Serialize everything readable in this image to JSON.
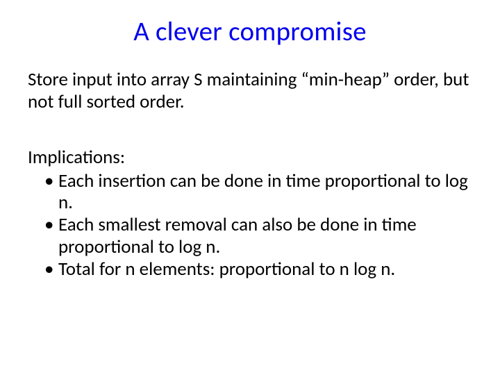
{
  "title": "A clever compromise",
  "intro": "Store input into array S maintaining “min-heap” order, but not full sorted order.",
  "implications_label": "Implications:",
  "bullets": [
    "Each insertion can be done in time proportional to log n.",
    "Each smallest removal can also be done in time proportional to log n.",
    "Total for n elements: proportional to n log n."
  ]
}
